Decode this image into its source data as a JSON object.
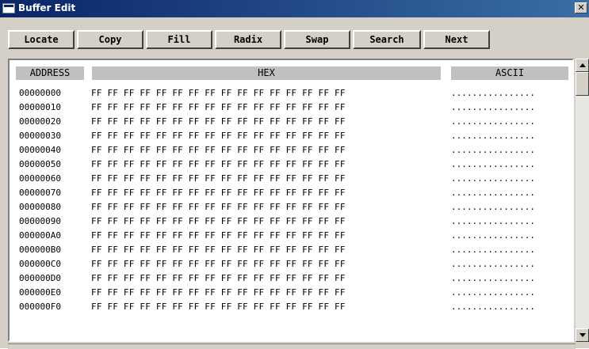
{
  "window": {
    "title": "Buffer Edit",
    "close_symbol": "✕"
  },
  "toolbar": {
    "buttons": [
      "Locate",
      "Copy",
      "Fill",
      "Radix",
      "Swap",
      "Search",
      "Next"
    ]
  },
  "table": {
    "headers": {
      "address": "ADDRESS",
      "hex": "HEX",
      "ascii": "ASCII"
    },
    "rows": [
      {
        "address": "00000000",
        "hex": "FF FF FF FF FF FF FF FF FF FF FF FF FF FF FF FF",
        "ascii": "................"
      },
      {
        "address": "00000010",
        "hex": "FF FF FF FF FF FF FF FF FF FF FF FF FF FF FF FF",
        "ascii": "................"
      },
      {
        "address": "00000020",
        "hex": "FF FF FF FF FF FF FF FF FF FF FF FF FF FF FF FF",
        "ascii": "................"
      },
      {
        "address": "00000030",
        "hex": "FF FF FF FF FF FF FF FF FF FF FF FF FF FF FF FF",
        "ascii": "................"
      },
      {
        "address": "00000040",
        "hex": "FF FF FF FF FF FF FF FF FF FF FF FF FF FF FF FF",
        "ascii": "................"
      },
      {
        "address": "00000050",
        "hex": "FF FF FF FF FF FF FF FF FF FF FF FF FF FF FF FF",
        "ascii": "................"
      },
      {
        "address": "00000060",
        "hex": "FF FF FF FF FF FF FF FF FF FF FF FF FF FF FF FF",
        "ascii": "................"
      },
      {
        "address": "00000070",
        "hex": "FF FF FF FF FF FF FF FF FF FF FF FF FF FF FF FF",
        "ascii": "................"
      },
      {
        "address": "00000080",
        "hex": "FF FF FF FF FF FF FF FF FF FF FF FF FF FF FF FF",
        "ascii": "................"
      },
      {
        "address": "00000090",
        "hex": "FF FF FF FF FF FF FF FF FF FF FF FF FF FF FF FF",
        "ascii": "................"
      },
      {
        "address": "000000A0",
        "hex": "FF FF FF FF FF FF FF FF FF FF FF FF FF FF FF FF",
        "ascii": "................"
      },
      {
        "address": "000000B0",
        "hex": "FF FF FF FF FF FF FF FF FF FF FF FF FF FF FF FF",
        "ascii": "................"
      },
      {
        "address": "000000C0",
        "hex": "FF FF FF FF FF FF FF FF FF FF FF FF FF FF FF FF",
        "ascii": "................"
      },
      {
        "address": "000000D0",
        "hex": "FF FF FF FF FF FF FF FF FF FF FF FF FF FF FF FF",
        "ascii": "................"
      },
      {
        "address": "000000E0",
        "hex": "FF FF FF FF FF FF FF FF FF FF FF FF FF FF FF FF",
        "ascii": "................"
      },
      {
        "address": "000000F0",
        "hex": "FF FF FF FF FF FF FF FF FF FF FF FF FF FF FF FF",
        "ascii": "................"
      }
    ]
  },
  "scrollbar": {
    "up_icon": "arrow-up",
    "down_icon": "arrow-down"
  }
}
